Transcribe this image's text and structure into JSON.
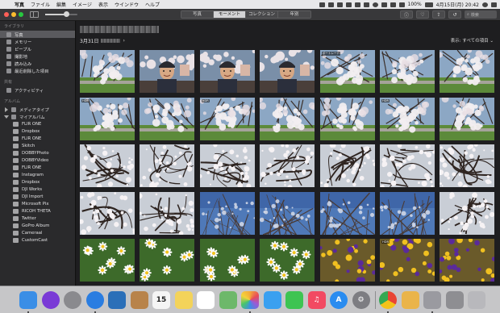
{
  "menubar": {
    "apple_glyph": "",
    "app_name": "写真",
    "items": [
      "ファイル",
      "編集",
      "イメージ",
      "表示",
      "ウインドウ",
      "ヘルプ"
    ],
    "battery": "100%",
    "clock": "4月15日(月) 20:42"
  },
  "toolbar": {
    "view_tabs": [
      "写真",
      "モーメント",
      "コレクション",
      "年別"
    ],
    "active_tab": "モーメント",
    "info_glyph": "ⓘ",
    "heart_glyph": "♡",
    "share_glyph": "⇪",
    "rotate_glyph": "↺",
    "search_placeholder": "検索",
    "zoom_level": 0.65
  },
  "sidebar": {
    "library_header": "ライブラリ",
    "library_items": [
      "写真",
      "メモリー",
      "ピープル",
      "撮影地",
      "読み込み",
      "最近削除した項目"
    ],
    "selected_item": "写真",
    "shared_header": "共有",
    "shared_items": [
      "アクティビティ"
    ],
    "albums_header": "アルバム",
    "album_groups": [
      "メディアタイプ",
      "マイアルバム"
    ],
    "my_albums": [
      "FLIR ONE",
      "Dropbox",
      "FLIR ONE",
      "Skitch",
      "DOBBYPhoto",
      "DOBBYVideo",
      "FLIR ONE",
      "Instagram",
      "Dropbox",
      "DJI Works",
      "DJI Import",
      "Microsoft Pix",
      "RICOH THETA",
      "Twitter",
      "GoPro Album",
      "Cameraal",
      "CustomCast"
    ]
  },
  "moment": {
    "date": "3月31日",
    "chevron": "›",
    "display_filter": "表示: すべての項目 ⌄"
  },
  "photos": {
    "rows": [
      [
        "sakura",
        "people",
        "people",
        "people",
        "sakura",
        "sakura",
        "sakura",
        "sakura"
      ],
      [
        "sakura",
        "sakura",
        "sakura",
        "sakura",
        "sakura",
        "sakura",
        "sakura",
        "sakura"
      ],
      [
        "branches",
        "branches",
        "branches",
        "branches",
        "branches",
        "branches",
        "branches",
        "branches"
      ],
      [
        "branches",
        "branches",
        "bluesky",
        "bluesky",
        "bluesky",
        "bluesky",
        "branches",
        "daisy"
      ],
      [
        "daisy",
        "daisy",
        "daisy",
        "daisy",
        "pansy",
        "pansy",
        "pansy",
        "pansy"
      ]
    ],
    "badges": [
      {
        "row": 0,
        "col": 4,
        "text": "ポートレート"
      },
      {
        "row": 1,
        "col": 0,
        "text": "HDR"
      },
      {
        "row": 1,
        "col": 2,
        "text": "HDR"
      },
      {
        "row": 1,
        "col": 5,
        "text": "HDR"
      },
      {
        "row": 4,
        "col": 5,
        "text": "HDR"
      }
    ]
  },
  "dock": {
    "icons": [
      {
        "name": "finder-icon",
        "color": "#3a8ee6",
        "glyph": ""
      },
      {
        "name": "siri-icon",
        "color": "#7a3ad6",
        "glyph": ""
      },
      {
        "name": "launchpad-icon",
        "color": "#8a8a8e",
        "glyph": ""
      },
      {
        "name": "safari-icon",
        "color": "#2a7de1",
        "glyph": ""
      },
      {
        "name": "preview-icon",
        "color": "#2b6fb8",
        "glyph": ""
      },
      {
        "name": "notes-icon",
        "color": "#b8834a",
        "glyph": ""
      },
      {
        "name": "calendar-icon",
        "color": "#f5f5f5",
        "glyph": "15"
      },
      {
        "name": "stickies-icon",
        "color": "#f3d35a",
        "glyph": ""
      },
      {
        "name": "reminders-icon",
        "color": "#ffffff",
        "glyph": ""
      },
      {
        "name": "maps-icon",
        "color": "#6db86a",
        "glyph": ""
      },
      {
        "name": "photos-icon",
        "color": "#ffffff",
        "glyph": ""
      },
      {
        "name": "messages-icon",
        "color": "#3aa0f0",
        "glyph": ""
      },
      {
        "name": "facetime-icon",
        "color": "#3ec452",
        "glyph": ""
      },
      {
        "name": "music-icon",
        "color": "#f24a62",
        "glyph": "♫"
      },
      {
        "name": "appstore-icon",
        "color": "#2a8cf0",
        "glyph": "A"
      },
      {
        "name": "system-preferences-icon",
        "color": "#7d7d82",
        "glyph": "⚙"
      },
      {
        "name": "chrome-icon",
        "color": "#e8e8e8",
        "glyph": ""
      },
      {
        "name": "photo-app-icon",
        "color": "#eab44a",
        "glyph": ""
      },
      {
        "name": "automator-icon",
        "color": "#9a9aa0",
        "glyph": ""
      },
      {
        "name": "files-icon",
        "color": "#8e8e92",
        "glyph": ""
      },
      {
        "name": "trash-icon",
        "color": "#b8b8bc",
        "glyph": ""
      }
    ]
  }
}
